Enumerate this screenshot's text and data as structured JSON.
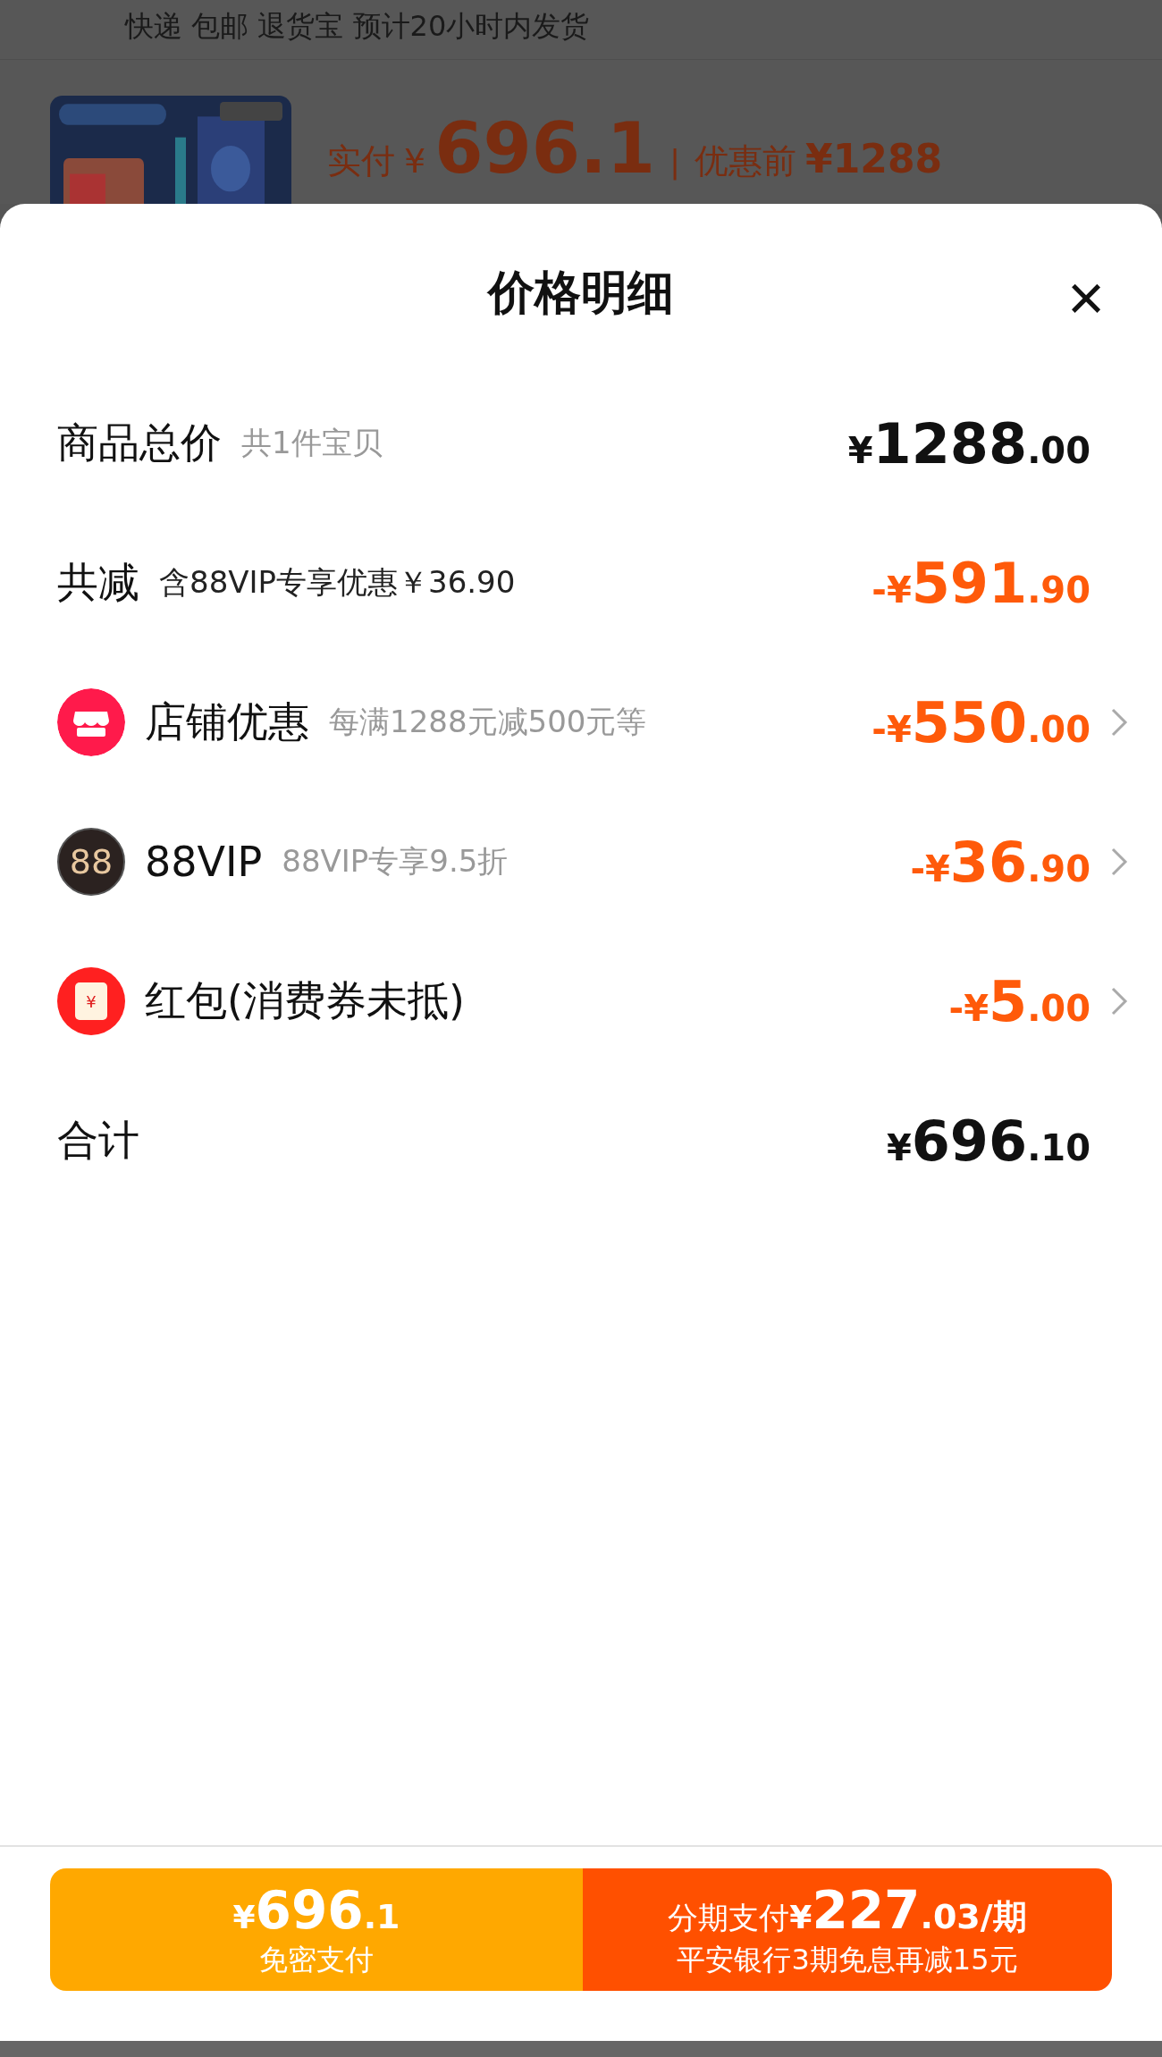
{
  "background": {
    "delivery_line": "快递 包邮 退货宝 预计20小时内发货",
    "price_label": "实付",
    "price_currency": "¥",
    "price_value": "696.1",
    "separator": "|",
    "original_label": "优惠前",
    "original_price": "¥1288"
  },
  "sheet": {
    "title": "价格明细",
    "close": "×"
  },
  "rows": [
    {
      "kind": "plain",
      "label": "商品总价",
      "note": "共1件宝贝",
      "discount": false,
      "sign": "¥",
      "integer": "1288",
      "decimal": ".00",
      "arrow": false
    },
    {
      "kind": "plain",
      "label": "共减",
      "note": "含88VIP专享优惠￥36.90",
      "discount": true,
      "sign": "-¥",
      "integer": "591",
      "decimal": ".90",
      "arrow": false,
      "note_dark": true
    },
    {
      "kind": "store",
      "label": "店铺优惠",
      "note": "每满1288元减500元等",
      "discount": true,
      "sign": "-¥",
      "integer": "550",
      "decimal": ".00",
      "arrow": true
    },
    {
      "kind": "vip",
      "badge": "88",
      "label": "88VIP",
      "note": "88VIP专享9.5折",
      "discount": true,
      "sign": "-¥",
      "integer": "36",
      "decimal": ".90",
      "arrow": true
    },
    {
      "kind": "redpacket",
      "badge": "¥",
      "label": "红包(消费券未抵)",
      "discount": true,
      "sign": "-¥",
      "integer": "5",
      "decimal": ".00",
      "arrow": true
    },
    {
      "kind": "plain",
      "label": "合计",
      "discount": false,
      "sign": "¥",
      "integer": "696",
      "decimal": ".10",
      "arrow": false
    }
  ],
  "buttons": [
    {
      "kind": "direct",
      "sign": "¥",
      "integer": "696",
      "decimal": ".1",
      "caption": "免密支付"
    },
    {
      "kind": "installment",
      "prefix": "分期支付",
      "sign": "¥",
      "integer": "227",
      "decimal": ".03/期",
      "caption": "平安银行3期免息再减15元"
    }
  ]
}
